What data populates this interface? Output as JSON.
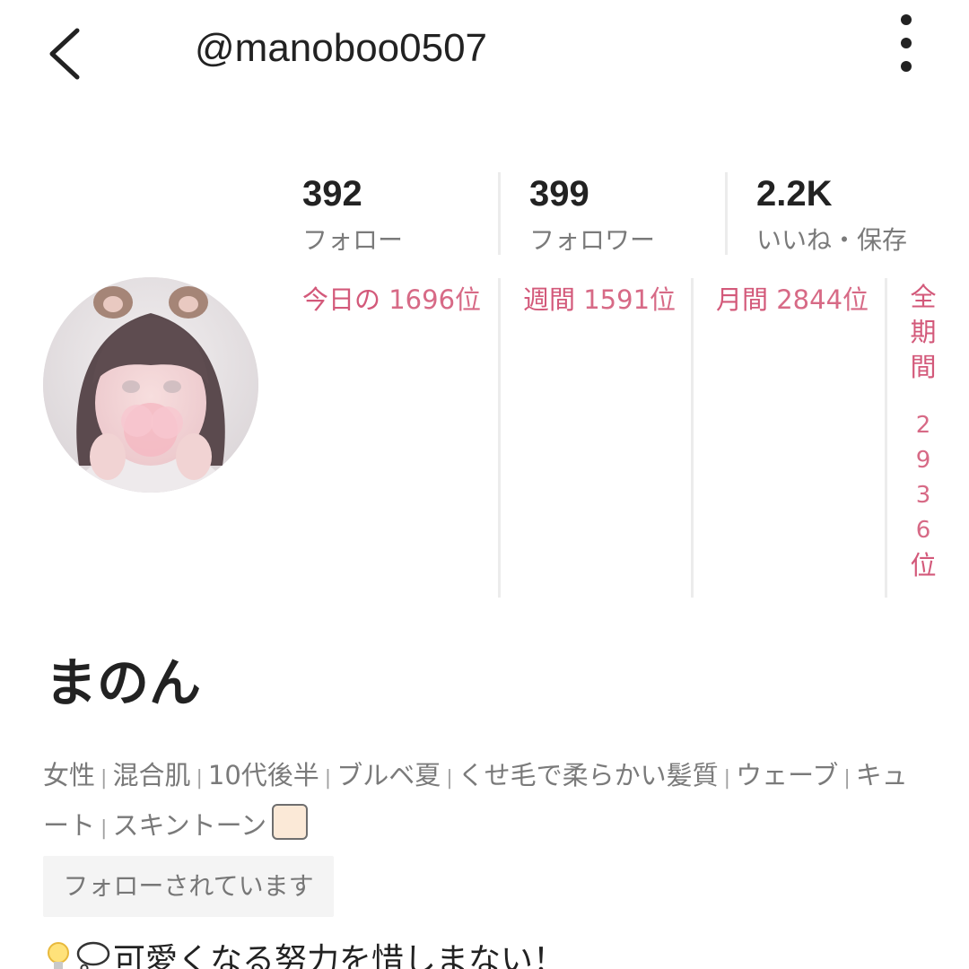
{
  "header": {
    "username": "@manoboo0507"
  },
  "stats": [
    {
      "value": "392",
      "label": "フォロー"
    },
    {
      "value": "399",
      "label": "フォロワー"
    },
    {
      "value": "2.2K",
      "label": "いいね・保存"
    }
  ],
  "rankings": {
    "today": {
      "label": "今日の",
      "rank": "1696位"
    },
    "weekly": {
      "label": "週間",
      "rank": "1591位"
    },
    "monthly": {
      "label": "月間",
      "rank": "2844位"
    },
    "all_time": {
      "label": [
        "全",
        "期",
        "間"
      ],
      "digits": [
        "2",
        "9",
        "3",
        "6"
      ],
      "suffix": "位"
    }
  },
  "profile": {
    "name": "まのん",
    "tags": [
      "女性",
      "混合肌",
      "10代後半",
      "ブルベ夏",
      "くせ毛で柔らかい髪質",
      "ウェーブ",
      "キュート",
      "スキントーン"
    ],
    "skin_tone_color": "#fbe9d7",
    "followed_badge": "フォローされています",
    "bio": "可愛くなる努力を惜しまない！"
  },
  "colors": {
    "accent": "#d3597a",
    "text": "#222222",
    "muted": "#7a7a7a"
  },
  "icons": {
    "back": "chevron-left-icon",
    "more": "more-vertical-icon",
    "bio_bulb": "lightbulb-icon",
    "bio_bubble": "thought-bubble-icon"
  }
}
